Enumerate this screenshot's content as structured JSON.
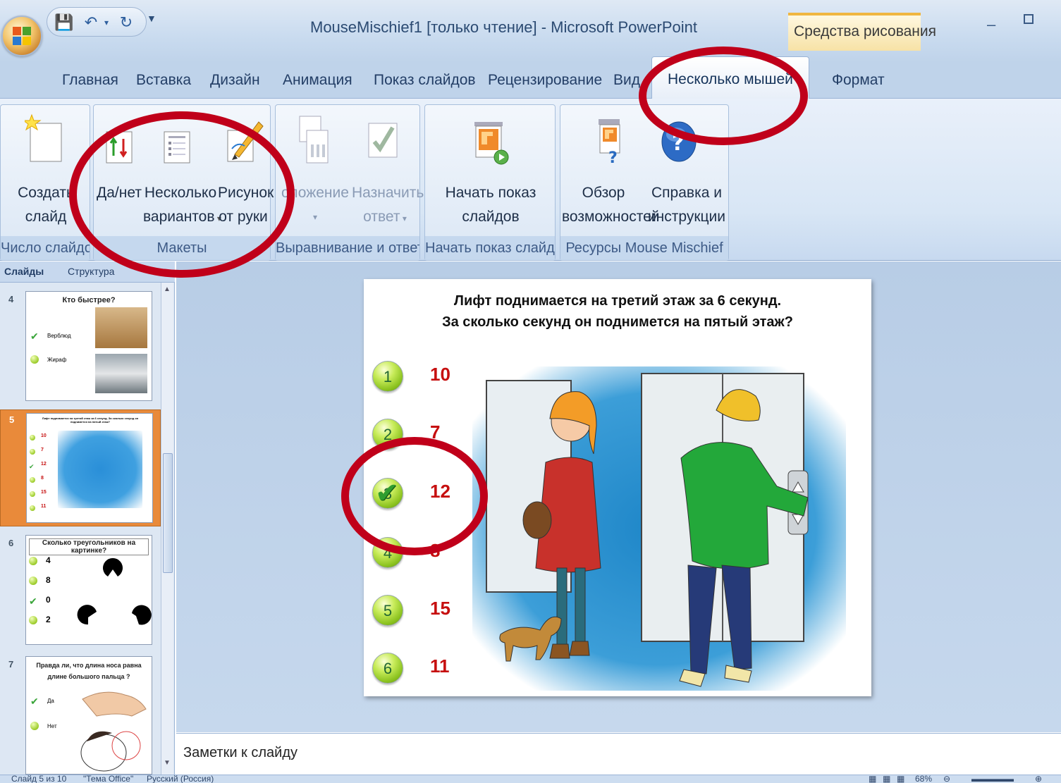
{
  "window": {
    "title": "MouseMischief1 [только чтение] - Microsoft PowerPoint",
    "context_tab_group": "Средства рисования"
  },
  "ribbon_tabs": [
    "Главная",
    "Вставка",
    "Дизайн",
    "Анимация",
    "Показ слайдов",
    "Рецензирование",
    "Вид",
    "Несколько мышей",
    "Формат"
  ],
  "active_tab": "Несколько мышей",
  "ribbon": {
    "groups": [
      {
        "label": "Число слайдов",
        "buttons": [
          "Создать\nслайд"
        ]
      },
      {
        "label": "Макеты",
        "buttons": [
          "Да/нет",
          "Несколько\nвариантов",
          "Рисунок\nот руки"
        ]
      },
      {
        "label": "Выравнивание и ответы",
        "buttons": [
          "Положение",
          "Назначить\nответ"
        ]
      },
      {
        "label": "Начать показ слайдов",
        "buttons": [
          "Начать показ\nслайдов"
        ]
      },
      {
        "label": "Ресурсы Mouse Mischief",
        "buttons": [
          "Обзор\nвозможностей",
          "Справка и\nинструкции"
        ]
      }
    ],
    "btn": {
      "create_l1": "Создать",
      "create_l2": "слайд",
      "yesno": "Да/нет",
      "multi_l1": "Несколько",
      "multi_l2": "вариантов",
      "draw_l1": "Рисунок",
      "draw_l2": "от руки",
      "position_l1": "оложение",
      "assign_l1": "Назначить",
      "assign_l2": "ответ",
      "start_l1": "Начать показ",
      "start_l2": "слайдов",
      "overview_l1": "Обзор",
      "overview_l2": "возможностей",
      "help_l1": "Справка и",
      "help_l2": "инструкции"
    }
  },
  "slides_pane": {
    "tabs": [
      "Слайды",
      "Структура"
    ],
    "close": "x",
    "thumbnails": [
      {
        "number": "4",
        "title": "Кто быстрее?",
        "answers": [
          "Верблюд",
          "Жираф"
        ]
      },
      {
        "number": "5",
        "title": "Лифт поднимается на третий этаж за 6 секунд. За сколько секунд он поднимется на пятый этаж?",
        "answers": [
          "10",
          "7",
          "12",
          "8",
          "15",
          "11"
        ]
      },
      {
        "number": "6",
        "title": "Сколько треугольников на картинке?",
        "answers": [
          "4",
          "8",
          "0",
          "2"
        ]
      },
      {
        "number": "7",
        "title": "Правда ли, что длина носа равна длине большого пальца ?",
        "answers": [
          "Да",
          "Нет"
        ]
      }
    ]
  },
  "slide": {
    "title_line1": "Лифт поднимается на третий этаж за 6 секунд.",
    "title_line2": "За сколько секунд он поднимется на пятый этаж?",
    "answers": [
      {
        "n": "1",
        "value": "10",
        "correct": false
      },
      {
        "n": "2",
        "value": "7",
        "correct": false
      },
      {
        "n": "3",
        "value": "12",
        "correct": true
      },
      {
        "n": "4",
        "value": "8",
        "correct": false
      },
      {
        "n": "5",
        "value": "15",
        "correct": false
      },
      {
        "n": "6",
        "value": "11",
        "correct": false
      }
    ]
  },
  "notes_placeholder": "Заметки к слайду",
  "status": {
    "slide_info": "Слайд 5 из 10",
    "theme": "\"Тема Office\"",
    "language": "Русский (Россия)",
    "zoom": "68%"
  },
  "colors": {
    "highlight": "#c0001a",
    "answer_text": "#c60f0f",
    "ribbon_bg": "#d8e6f5",
    "workspace_bg": "#c6d8ed"
  }
}
